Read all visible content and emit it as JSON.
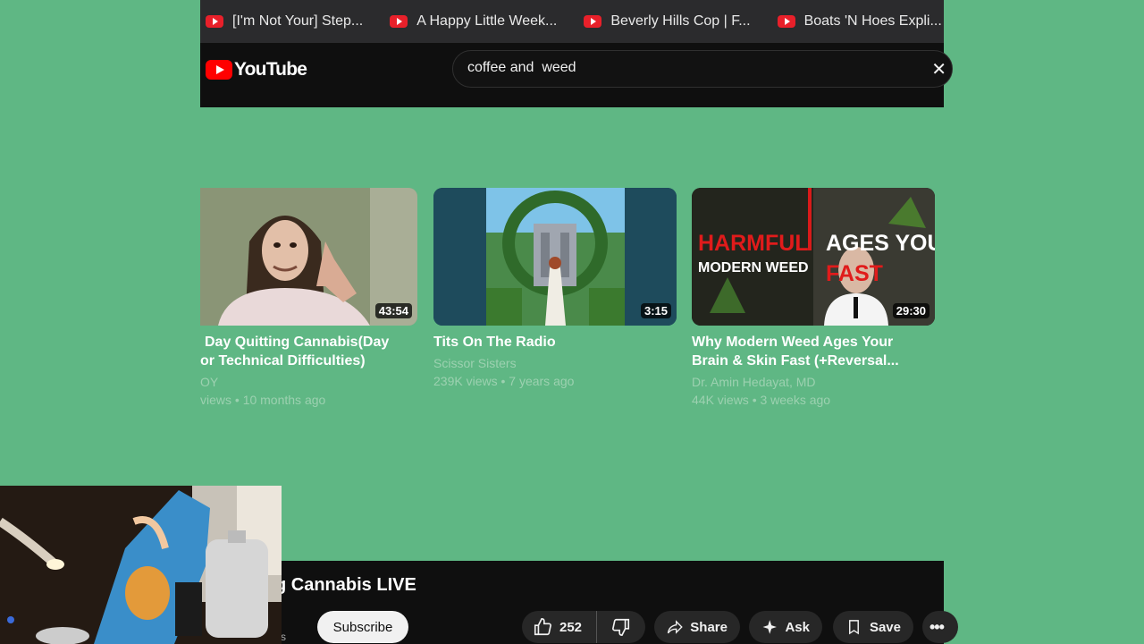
{
  "tabs": [
    {
      "title": "[I'm Not Your] Step..."
    },
    {
      "title": "A Happy Little Week..."
    },
    {
      "title": "Beverly Hills Cop | F..."
    },
    {
      "title": "Boats 'N Hoes Expli..."
    }
  ],
  "header": {
    "logo_text": "YouTube",
    "search_value": "coffee and  weed"
  },
  "videos": [
    {
      "title_line1": "Day Quitting Cannabis(Day",
      "title_line2": "or Technical Difficulties)",
      "channel": "OY",
      "stats": "views • 10 months ago",
      "duration": "43:54"
    },
    {
      "title_line1": "Tits On The Radio",
      "title_line2": "",
      "channel": "Scissor Sisters",
      "stats": "239K views • 7 years ago",
      "duration": "3:15"
    },
    {
      "title_line1": "Why Modern Weed Ages Your",
      "title_line2": "Brain & Skin Fast (+Reversal...",
      "channel": "Dr. Amin Hedayat, MD",
      "stats": "44K views • 3 weeks ago",
      "duration": "29:30",
      "thumb_text": {
        "harmful": "HARMFUL",
        "modern_weed": "MODERN WEED",
        "ages_you": "AGES YOU",
        "fast": "FAST"
      }
    }
  ],
  "player": {
    "title": "g Cannabis LIVE",
    "subscribe_label": "Subscribe",
    "like_count": "252",
    "share_label": "Share",
    "ask_label": "Ask",
    "save_label": "Save",
    "subscriber_fragment": "rs"
  },
  "colors": {
    "background": "#5fb784",
    "youtube_red": "#ff0000",
    "header_bg": "#0f0f0f"
  }
}
